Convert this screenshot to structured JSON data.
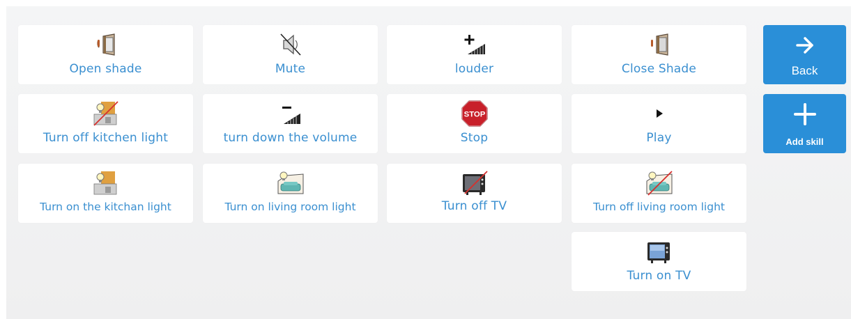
{
  "tiles": [
    {
      "id": "open-shade",
      "label": "Open shade",
      "icon": "window-shade-icon"
    },
    {
      "id": "mute",
      "label": "Mute",
      "icon": "speaker-muted-icon"
    },
    {
      "id": "louder",
      "label": "louder",
      "icon": "volume-up-icon"
    },
    {
      "id": "close-shade",
      "label": "Close Shade",
      "icon": "window-shade-icon"
    },
    {
      "id": "turn-off-kitchen-light",
      "label": "Turn off kitchen light",
      "icon": "kitchen-light-off-icon"
    },
    {
      "id": "turn-down-volume",
      "label": "turn down the volume",
      "icon": "volume-down-icon"
    },
    {
      "id": "stop",
      "label": "Stop",
      "icon": "stop-sign-icon",
      "icon_text": "STOP"
    },
    {
      "id": "play",
      "label": "Play",
      "icon": "play-icon"
    },
    {
      "id": "turn-on-kitchen-light",
      "label": "Turn on the kitchan light",
      "icon": "kitchen-light-on-icon"
    },
    {
      "id": "turn-on-living-room-light",
      "label": "Turn on living room light",
      "icon": "living-room-light-on-icon"
    },
    {
      "id": "turn-off-tv",
      "label": "Turn off TV",
      "icon": "tv-off-icon"
    },
    {
      "id": "turn-off-living-room-light",
      "label": "Turn off living room light",
      "icon": "living-room-light-off-icon"
    },
    {
      "id": "turn-on-tv",
      "label": "Turn on TV",
      "icon": "tv-icon"
    }
  ],
  "side_buttons": {
    "back": {
      "label": "Back",
      "icon": "arrow-right-icon"
    },
    "add_skill": {
      "label": "Add skill",
      "icon": "plus-icon"
    }
  },
  "colors": {
    "accent": "#2a8fd8",
    "label": "#3a8fd0",
    "background": "#f1f2f3"
  }
}
